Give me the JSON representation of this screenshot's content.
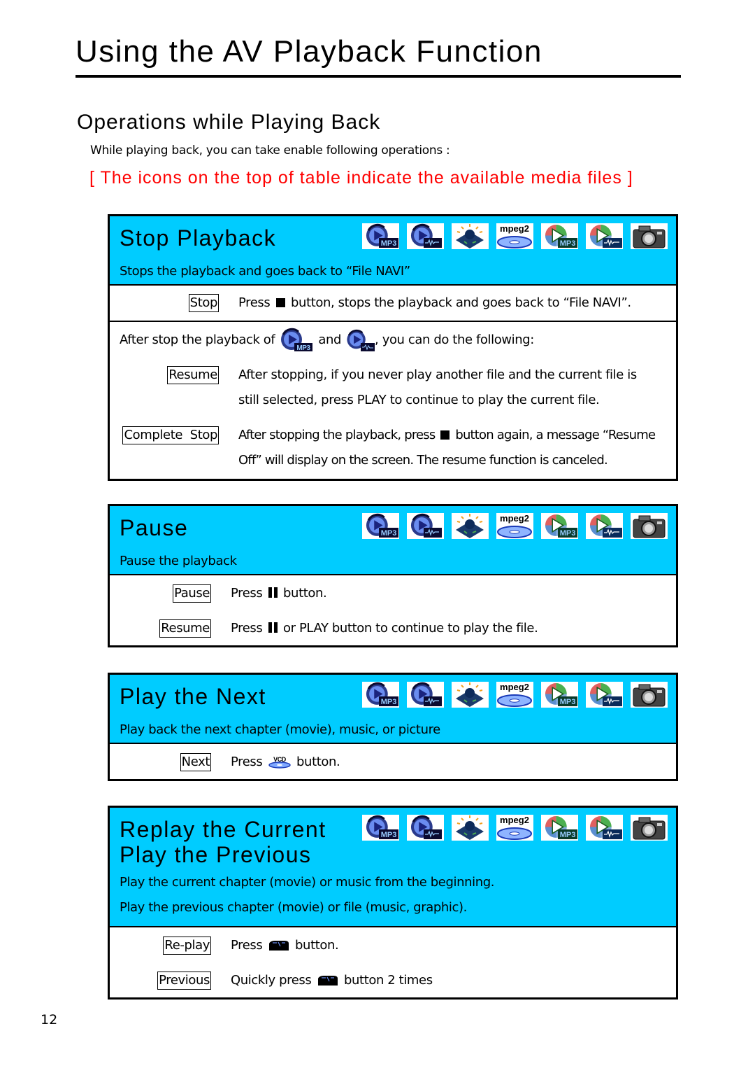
{
  "page": {
    "title": "Using the AV Playback Function",
    "section_title": "Operations while Playing Back",
    "intro": "While playing back, you can take enable following operations :",
    "notice": "[ The icons on the top of table indicate the available media files ]",
    "page_number": "12"
  },
  "colors": {
    "header_bg": "#00ccff",
    "notice": "#ff0000"
  },
  "media_icons": [
    {
      "name": "mp3-music-icon",
      "label": "MP3"
    },
    {
      "name": "wave-music-icon",
      "label": "WAV"
    },
    {
      "name": "picture-icon",
      "label": ""
    },
    {
      "name": "mpeg2-disc-icon",
      "label": "mpeg2"
    },
    {
      "name": "mp3-video-icon",
      "label": "MP3"
    },
    {
      "name": "wave-video-icon",
      "label": "WAV"
    },
    {
      "name": "camera-icon",
      "label": ""
    }
  ],
  "stop_playback": {
    "title": "Stop Playback",
    "description": "Stops the playback and goes back to “File NAVI”",
    "stop_key": "Stop",
    "stop_pre": "Press",
    "stop_post": "button, stops the playback and goes back to “File NAVI”.",
    "after_pre": "After stop the playback of",
    "after_and": "and",
    "after_post": ", you can do the following:",
    "resume_key": "Resume",
    "resume_line1": "After stopping, if you never play another file and the current file is",
    "resume_line2": "still selected, press PLAY to continue to play the current file.",
    "complete_key": "Complete  Stop",
    "complete_pre": "After stopping the playback, press",
    "complete_post": "button again, a message “Resume",
    "complete_line2": "Off” will display on the screen. The resume function is canceled."
  },
  "pause": {
    "title": "Pause",
    "description": "Pause the playback",
    "pause_key": "Pause",
    "pause_pre": "Press",
    "pause_post": "button.",
    "resume_key": "Resume",
    "resume_pre": "Press",
    "resume_post": "or PLAY button to continue to play the file."
  },
  "play_next": {
    "title": "Play the Next",
    "description": "Play back the next chapter (movie), music, or picture",
    "next_key": "Next",
    "next_pre": "Press",
    "next_post": "button.",
    "vcd_label": "VCD"
  },
  "replay": {
    "title_line1": "Replay the Current",
    "title_line2": "Play the Previous",
    "description1": "Play the current chapter (movie) or music from the beginning.",
    "description2": "Play the previous chapter (movie) or file (music, graphic).",
    "replay_key": "Re-play",
    "replay_pre": "Press",
    "replay_post": "button.",
    "previous_key": "Previous",
    "previous_pre": "Quickly press",
    "previous_post": "button 2 times"
  }
}
